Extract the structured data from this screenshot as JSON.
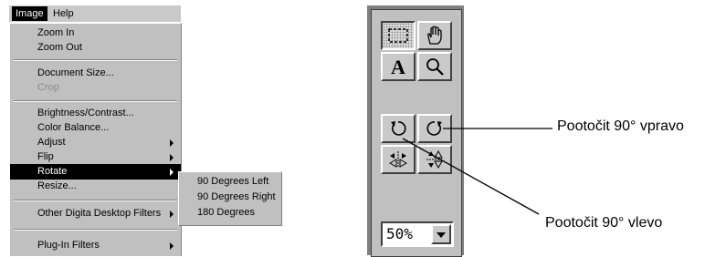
{
  "menubar": {
    "image": "Image",
    "help": "Help"
  },
  "menu": {
    "zoom_in": "Zoom In",
    "zoom_out": "Zoom Out",
    "document_size": "Document Size...",
    "crop": "Crop",
    "brightness_contrast": "Brightness/Contrast...",
    "color_balance": "Color Balance...",
    "adjust": "Adjust",
    "flip": "Flip",
    "rotate": "Rotate",
    "resize": "Resize...",
    "other_filters": "Other Digita Desktop Filters",
    "plugin_filters": "Plug-In Filters"
  },
  "submenu": {
    "left": "90 Degrees Left",
    "right": "90 Degrees Right",
    "deg180": "180 Degrees"
  },
  "toolbar": {
    "zoom_value": "50%",
    "icons": [
      "selection-marquee-icon",
      "hand-icon",
      "text-tool-icon",
      "magnifier-icon",
      "rotate-left-icon",
      "rotate-right-icon",
      "flip-horizontal-icon",
      "flip-vertical-icon"
    ]
  },
  "callouts": {
    "right": "Pootočit 90° vpravo",
    "left": "Pootočit 90° vlevo"
  }
}
